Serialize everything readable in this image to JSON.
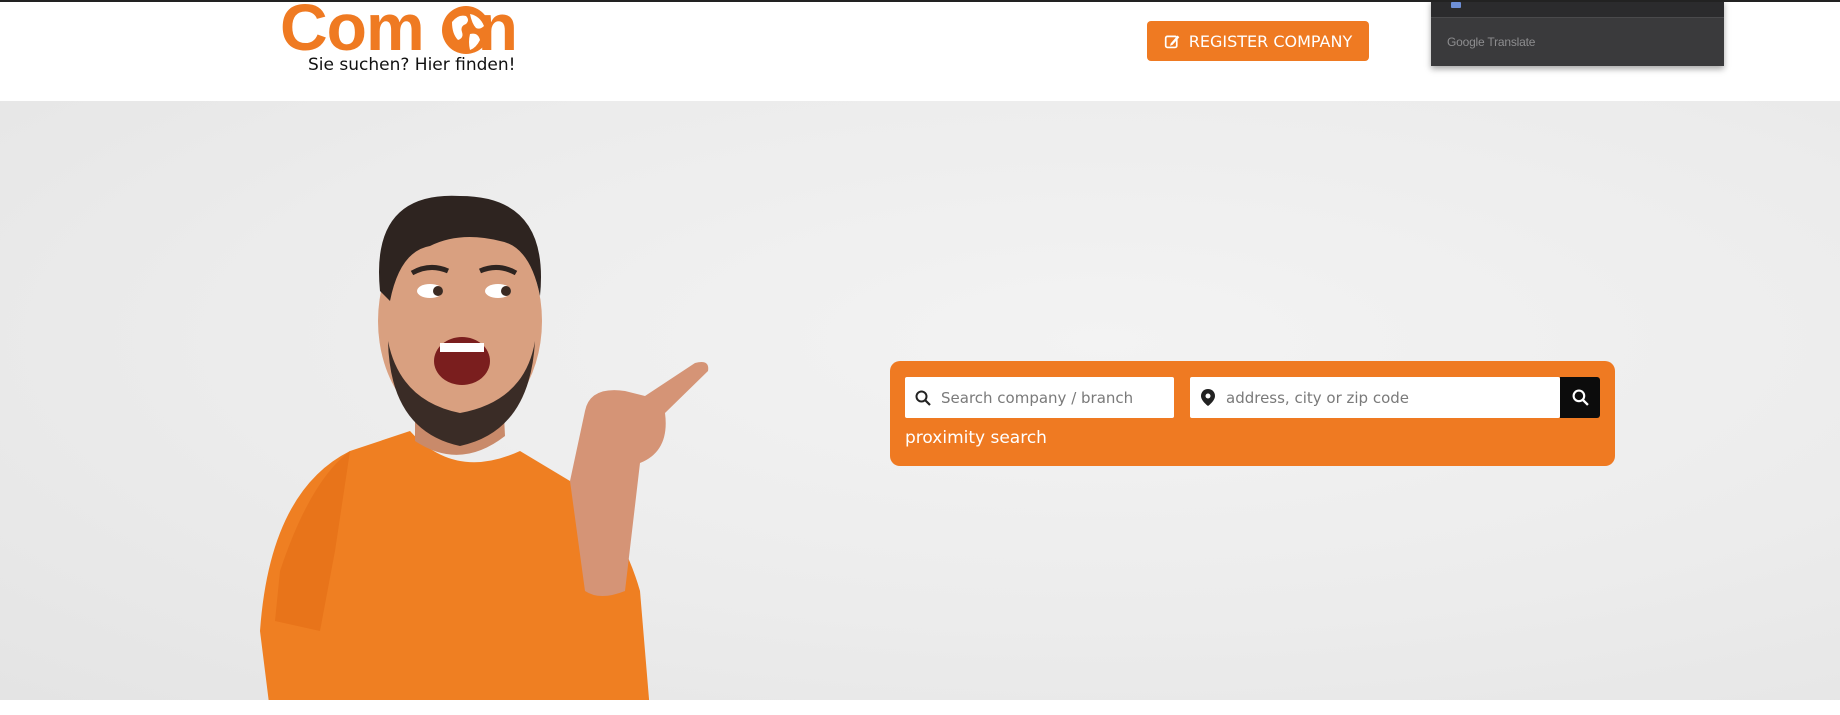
{
  "header": {
    "logo_text": "Com On",
    "logo_tagline": "Sie suchen? Hier finden!",
    "register_button_label": "REGISTER COMPANY",
    "register_icon": "edit-icon"
  },
  "translate_widget": {
    "brand": "Google Translate"
  },
  "hero": {
    "image_description_icon": "person-pointing-image"
  },
  "search": {
    "company_placeholder": "Search company / branch",
    "location_placeholder": "address, city or zip code",
    "company_icon": "search-icon",
    "location_icon": "map-pin-icon",
    "submit_icon": "search-icon",
    "proximity_label": "proximity search"
  },
  "colors": {
    "brand_orange": "#ef7a22",
    "search_button": "#0c0c0c",
    "hero_background": "#ececec"
  }
}
